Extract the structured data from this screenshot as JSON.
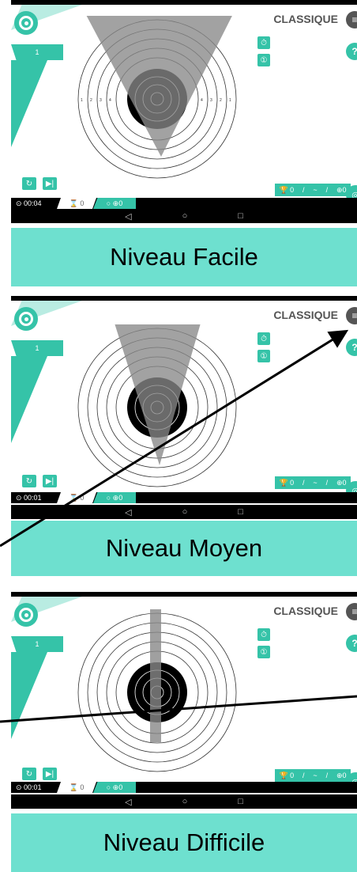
{
  "app": {
    "mode_title": "CLASSIQUE",
    "menu_glyph": "≡",
    "help_glyph": "?",
    "level_number": "1",
    "ring_numbers": [
      "1",
      "2",
      "3",
      "4",
      "5",
      "6",
      "7",
      "8"
    ],
    "accent_color": "#35c3a8",
    "band_color": "#6ee0cf"
  },
  "panels": [
    {
      "level_label": "Niveau Facile",
      "timer": "⊙ 00:04",
      "shots": "⌛ 0",
      "hits": "○ ⊕0",
      "score_trophy": "🏆 0",
      "score_sep1": "/",
      "score_dash": "~",
      "score_sep2": "/",
      "score_target": "⊕0"
    },
    {
      "level_label": "Niveau Moyen",
      "timer": "⊙ 00:01",
      "shots": "⌛ 0",
      "hits": "○ ⊕0",
      "score_trophy": "🏆 0",
      "score_sep1": "/",
      "score_dash": "~",
      "score_sep2": "/",
      "score_target": "⊕0"
    },
    {
      "level_label": "Niveau Difficile",
      "timer": "⊙ 00:01",
      "shots": "⌛ 0",
      "hits": "○ ⊕0",
      "score_trophy": "🏆 0",
      "score_sep1": "/",
      "score_dash": "~",
      "score_sep2": "/",
      "score_target": "⊕0"
    }
  ],
  "buttons": {
    "restart": "↻",
    "next": "▶|",
    "timer_icon": "⏱",
    "one_icon": "①"
  },
  "nav": {
    "back": "◁",
    "home": "○",
    "recent": "□"
  }
}
